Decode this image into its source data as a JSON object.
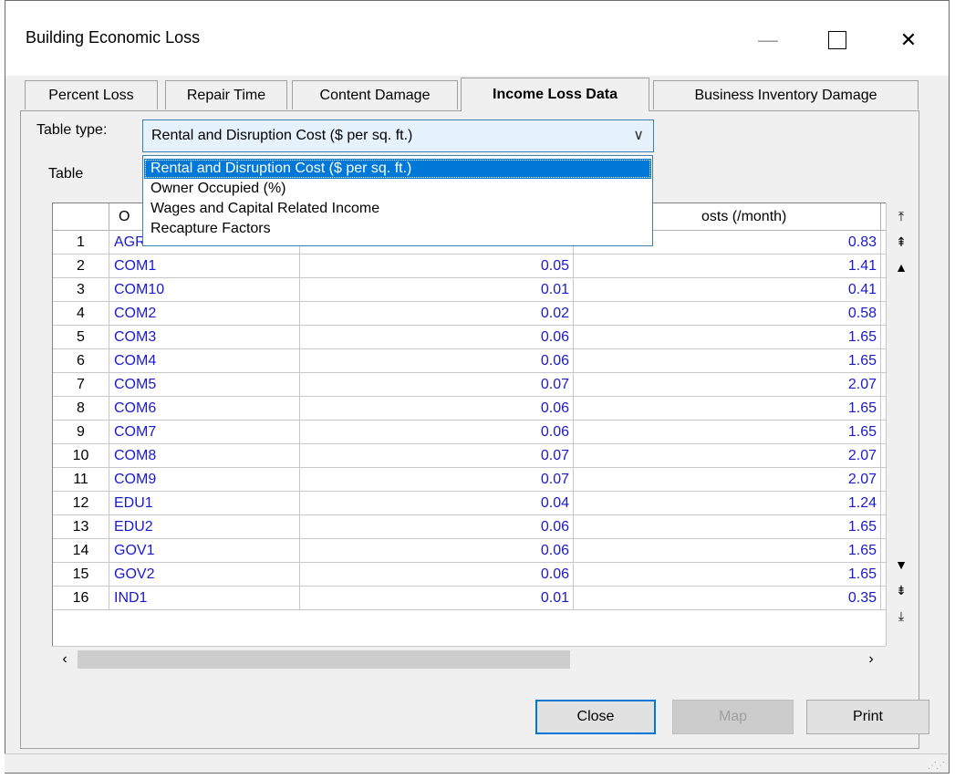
{
  "window": {
    "title": "Building Economic Loss",
    "minimize": "—",
    "close": "✕"
  },
  "tabs": [
    {
      "label": "Percent Loss",
      "active": false
    },
    {
      "label": "Repair Time",
      "active": false
    },
    {
      "label": "Content Damage",
      "active": false
    },
    {
      "label": "Income Loss Data",
      "active": true
    },
    {
      "label": "Business Inventory Damage",
      "active": false
    }
  ],
  "table_type": {
    "label": "Table type:",
    "selected": "Rental and Disruption Cost ($ per sq. ft.)",
    "options": [
      "Rental and Disruption Cost ($ per sq. ft.)",
      "Owner Occupied (%)",
      "Wages and Capital Related Income",
      "Recapture Factors"
    ]
  },
  "table": {
    "label": "Table",
    "headers": [
      "O",
      "",
      "osts (/month)"
    ],
    "rows": [
      {
        "num": "1",
        "occ": "AGR",
        "v1": "",
        "v2": "0.83"
      },
      {
        "num": "2",
        "occ": "COM1",
        "v1": "0.05",
        "v2": "1.41"
      },
      {
        "num": "3",
        "occ": "COM10",
        "v1": "0.01",
        "v2": "0.41"
      },
      {
        "num": "4",
        "occ": "COM2",
        "v1": "0.02",
        "v2": "0.58"
      },
      {
        "num": "5",
        "occ": "COM3",
        "v1": "0.06",
        "v2": "1.65"
      },
      {
        "num": "6",
        "occ": "COM4",
        "v1": "0.06",
        "v2": "1.65"
      },
      {
        "num": "7",
        "occ": "COM5",
        "v1": "0.07",
        "v2": "2.07"
      },
      {
        "num": "8",
        "occ": "COM6",
        "v1": "0.06",
        "v2": "1.65"
      },
      {
        "num": "9",
        "occ": "COM7",
        "v1": "0.06",
        "v2": "1.65"
      },
      {
        "num": "10",
        "occ": "COM8",
        "v1": "0.07",
        "v2": "2.07"
      },
      {
        "num": "11",
        "occ": "COM9",
        "v1": "0.07",
        "v2": "2.07"
      },
      {
        "num": "12",
        "occ": "EDU1",
        "v1": "0.04",
        "v2": "1.24"
      },
      {
        "num": "13",
        "occ": "EDU2",
        "v1": "0.06",
        "v2": "1.65"
      },
      {
        "num": "14",
        "occ": "GOV1",
        "v1": "0.06",
        "v2": "1.65"
      },
      {
        "num": "15",
        "occ": "GOV2",
        "v1": "0.06",
        "v2": "1.65"
      },
      {
        "num": "16",
        "occ": "IND1",
        "v1": "0.01",
        "v2": "0.35"
      }
    ]
  },
  "buttons": {
    "close": "Close",
    "map": "Map",
    "print": "Print"
  },
  "colors": {
    "accent": "#0078d7",
    "cell_text": "#1a1acc"
  }
}
